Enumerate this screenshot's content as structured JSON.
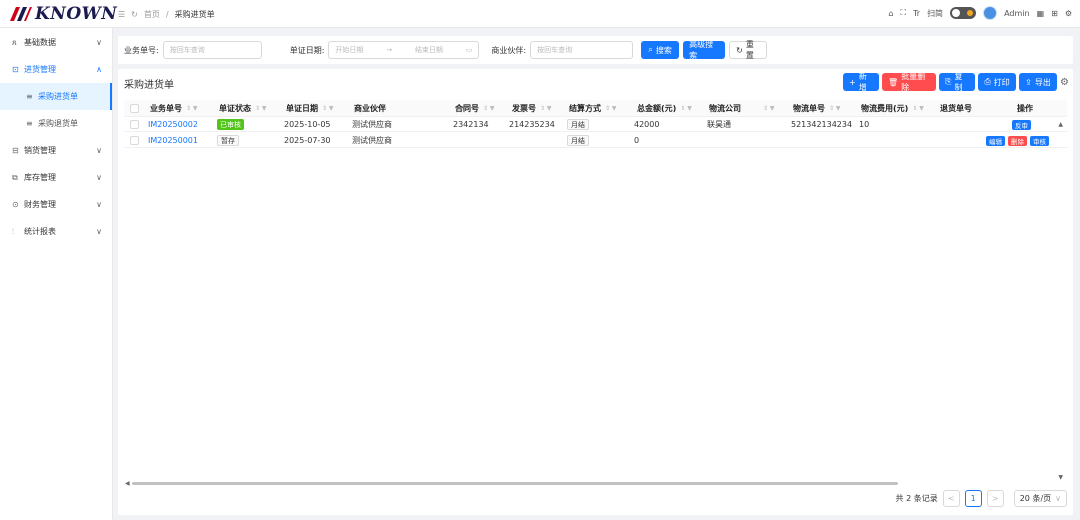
{
  "app": {
    "logo_text": "KNOWN"
  },
  "breadcrumb": {
    "home": "首页",
    "sep": "/",
    "current": "采购进货单"
  },
  "topbar": {
    "font_icon": "Tr",
    "lang": "扫简",
    "user": "Admin"
  },
  "sidebar": {
    "items": [
      {
        "label": "基础数据",
        "icon": "user-icon",
        "arrow": "∨"
      },
      {
        "label": "进货管理",
        "icon": "inbox-icon",
        "arrow": "∧"
      },
      {
        "label": "采购进货单",
        "icon": "list-icon"
      },
      {
        "label": "采购退货单",
        "icon": "list-icon"
      },
      {
        "label": "销货管理",
        "icon": "outbox-icon",
        "arrow": "∨"
      },
      {
        "label": "库存管理",
        "icon": "stock-icon",
        "arrow": "∨"
      },
      {
        "label": "财务管理",
        "icon": "finance-icon",
        "arrow": "∨"
      },
      {
        "label": "统计报表",
        "icon": "chart-icon",
        "arrow": "∨"
      }
    ]
  },
  "filter": {
    "biz_no_label": "业务单号:",
    "biz_no_placeholder": "按回车查询",
    "date_label": "单证日期:",
    "date_start": "开始日期",
    "date_arrow": "→",
    "date_end": "结束日期",
    "partner_label": "商业伙伴:",
    "partner_placeholder": "按回车查询",
    "search": "搜索",
    "advanced": "高级搜索",
    "reset": "重置"
  },
  "panel": {
    "title": "采购进货单",
    "actions": {
      "add": "新增",
      "batch_delete": "批量删除",
      "copy": "复制",
      "print": "打印",
      "export": "导出"
    }
  },
  "table": {
    "columns": [
      "业务单号",
      "单证状态",
      "单证日期",
      "商业伙伴",
      "合同号",
      "发票号",
      "结算方式",
      "总金额(元)",
      "物流公司",
      "物流单号",
      "物流费用(元)",
      "退货单号",
      "操作"
    ],
    "rows": [
      {
        "no": "IM20250002",
        "status": "已审核",
        "date": "2025-10-05",
        "partner": "测试供应商",
        "contract": "2342134",
        "invoice": "214235234",
        "settle": "月结",
        "amount": "42000",
        "logistics": "联昊通",
        "logistics_no": "521342134234",
        "fee": "10",
        "return_no": "",
        "ops": [
          "反审"
        ]
      },
      {
        "no": "IM20250001",
        "status": "暂存",
        "date": "2025-07-30",
        "partner": "测试供应商",
        "contract": "",
        "invoice": "",
        "settle": "月结",
        "amount": "0",
        "logistics": "",
        "logistics_no": "",
        "fee": "",
        "return_no": "",
        "ops": [
          "编辑",
          "删除",
          "审核"
        ]
      }
    ]
  },
  "pagination": {
    "total": "共 2 条记录",
    "prev": "<",
    "page": "1",
    "next": ">",
    "size": "20 条/页"
  }
}
